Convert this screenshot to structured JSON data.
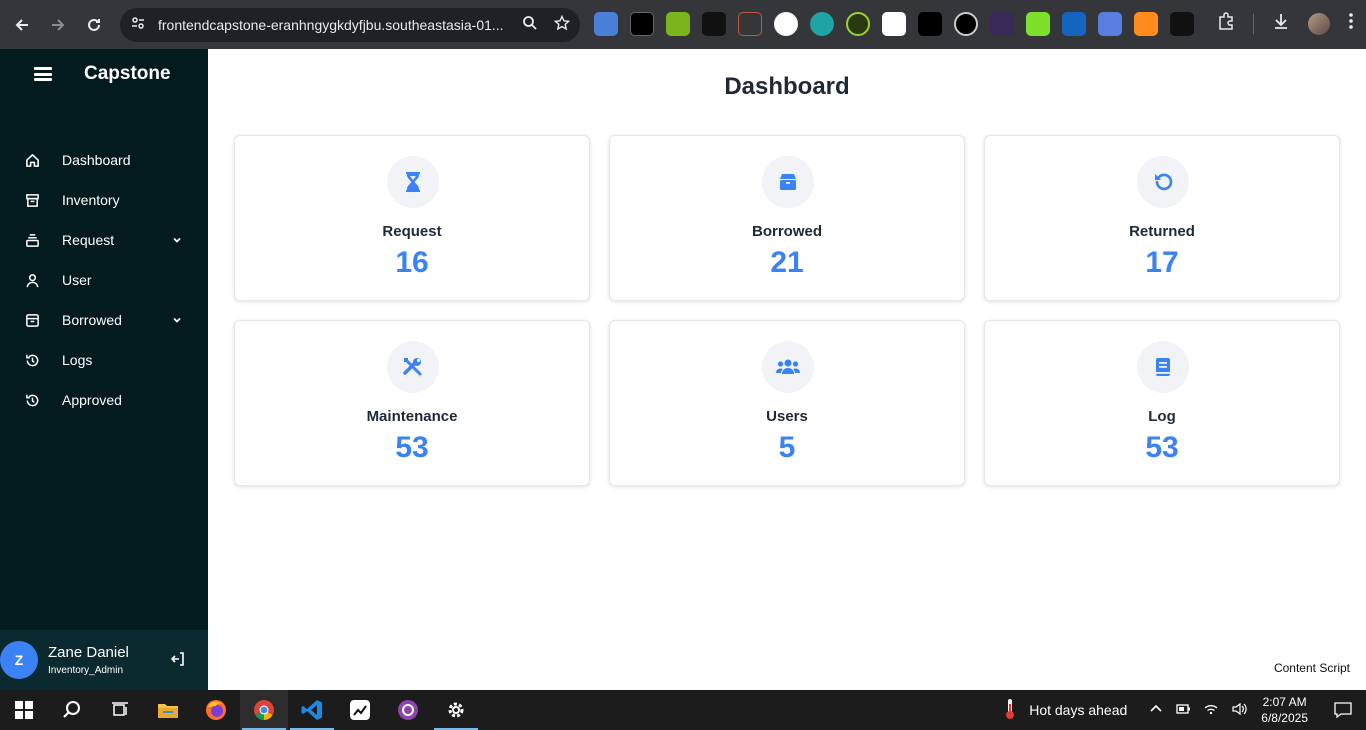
{
  "browser": {
    "url": "frontendcapstone-eranhngygkdyfjbu.southeastasia-01..."
  },
  "sidebar": {
    "brand": "Capstone",
    "items": [
      {
        "label": "Dashboard",
        "icon": "home-icon"
      },
      {
        "label": "Inventory",
        "icon": "archive-icon"
      },
      {
        "label": "Request",
        "icon": "stack-icon",
        "has_dropdown": true
      },
      {
        "label": "User",
        "icon": "user-icon"
      },
      {
        "label": "Borrowed",
        "icon": "box-icon",
        "has_dropdown": true
      },
      {
        "label": "Logs",
        "icon": "history-icon"
      },
      {
        "label": "Approved",
        "icon": "history-icon"
      }
    ],
    "user": {
      "initial": "Z",
      "name": "Zane Daniel",
      "role": "Inventory_Admin"
    }
  },
  "main": {
    "title": "Dashboard",
    "cards": [
      {
        "label": "Request",
        "value": "16",
        "icon": "hourglass-icon"
      },
      {
        "label": "Borrowed",
        "value": "21",
        "icon": "box-icon"
      },
      {
        "label": "Returned",
        "value": "17",
        "icon": "undo-icon"
      },
      {
        "label": "Maintenance",
        "value": "53",
        "icon": "tools-icon"
      },
      {
        "label": "Users",
        "value": "5",
        "icon": "users-icon"
      },
      {
        "label": "Log",
        "value": "53",
        "icon": "book-icon"
      }
    ],
    "content_script": "Content Script"
  },
  "taskbar": {
    "weather": "Hot days ahead",
    "time": "2:07 AM",
    "date": "6/8/2025"
  },
  "colors": {
    "sidebar_bg": "#031b1f",
    "accent": "#3b82f6"
  }
}
